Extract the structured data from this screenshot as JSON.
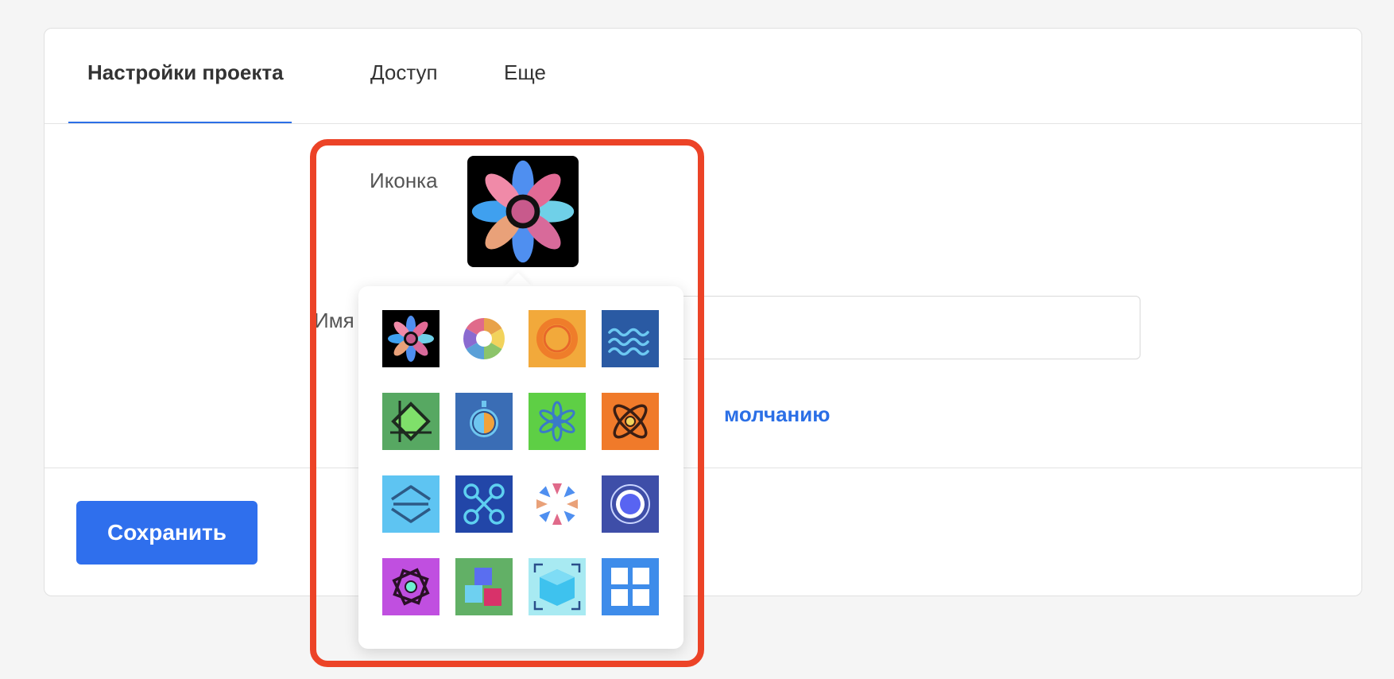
{
  "tabs": {
    "project_settings": "Настройки проекта",
    "access": "Доступ",
    "more": "Еще"
  },
  "form": {
    "icon_label": "Иконка",
    "name_label": "Имя",
    "default_link": "молчанию",
    "save_label": "Сохранить"
  },
  "icon_picker": {
    "selected": "flower-icon",
    "icons": [
      {
        "name": "flower-icon",
        "bg": "#000000"
      },
      {
        "name": "color-wheel-icon",
        "bg": "#ffffff"
      },
      {
        "name": "orange-ring-icon",
        "bg": "#f2a93b"
      },
      {
        "name": "waves-icon",
        "bg": "#2a5aa3"
      },
      {
        "name": "diamond-frame-icon",
        "bg": "#57a862"
      },
      {
        "name": "orb-icon",
        "bg": "#3a6db5"
      },
      {
        "name": "star-flower-icon",
        "bg": "#5ecf45"
      },
      {
        "name": "atom-icon",
        "bg": "#f07a2a"
      },
      {
        "name": "hexagon-arrows-icon",
        "bg": "#5ec4f2"
      },
      {
        "name": "nodes-icon",
        "bg": "#2246a8"
      },
      {
        "name": "petal-ring-icon",
        "bg": "#ffffff"
      },
      {
        "name": "target-icon",
        "bg": "#3e4ea8"
      },
      {
        "name": "pinwheel-icon",
        "bg": "#c04fe0"
      },
      {
        "name": "cubes-icon",
        "bg": "#62b066"
      },
      {
        "name": "ice-cube-icon",
        "bg": "#a8eaf2"
      },
      {
        "name": "grid-icon",
        "bg": "#3e8cea"
      }
    ]
  },
  "colors": {
    "accent": "#2f6fed",
    "highlight": "#ec4327"
  }
}
